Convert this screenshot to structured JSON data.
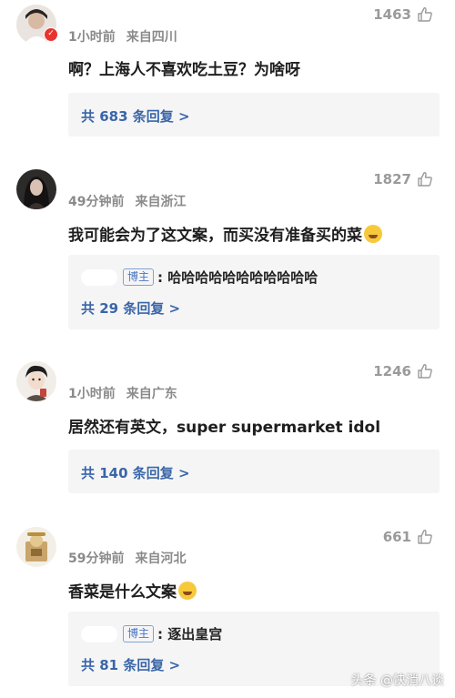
{
  "comments": [
    {
      "likes": "1463",
      "time": "1小时前",
      "location": "来自四川",
      "text": "啊？上海人不喜欢吃土豆？为啥呀",
      "reply_link": "共 683 条回复 >"
    },
    {
      "likes": "1827",
      "time": "49分钟前",
      "location": "来自浙江",
      "text": "我可能会为了这文案，而买没有准备买的菜",
      "reply_badge": "博主",
      "reply_text": ": 哈哈哈哈哈哈哈哈哈哈哈",
      "reply_link": "共 29 条回复 >"
    },
    {
      "likes": "1246",
      "time": "1小时前",
      "location": "来自广东",
      "text": "居然还有英文，super supermarket idol",
      "reply_link": "共 140 条回复 >"
    },
    {
      "likes": "661",
      "time": "59分钟前",
      "location": "来自河北",
      "text": "香菜是什么文案",
      "reply_badge": "博主",
      "reply_text": ": 逐出皇宫",
      "reply_link": "共 81 条回复 >"
    }
  ],
  "watermark": "头条 @快消八谈",
  "colors": {
    "link": "#3a66a8",
    "meta": "#8a8a8a",
    "reply_bg": "#f5f5f6",
    "badge_border": "#7fa3d6"
  },
  "icons": {
    "like": "thumbs-up-icon",
    "verified": "verified-badge-icon",
    "emoji": "laughing-emoji-icon"
  }
}
